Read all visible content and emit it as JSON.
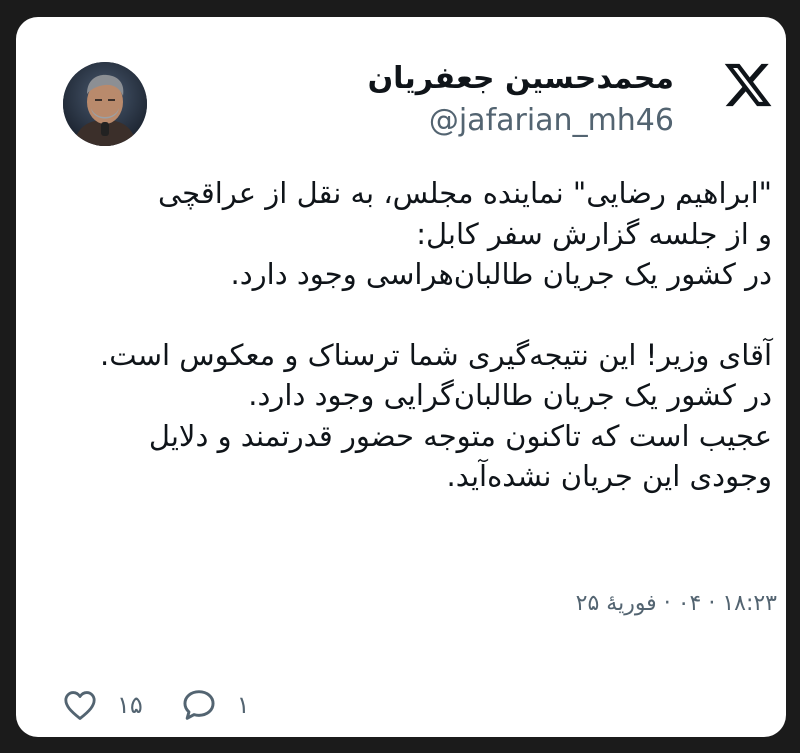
{
  "author": {
    "display_name": "محمدحسین جعفریان",
    "handle": "@jafarian_mh46"
  },
  "icons": {
    "platform": "x-logo-icon",
    "like": "heart-icon",
    "reply": "speech-bubble-icon"
  },
  "tweet": {
    "paragraph_1": "\"ابراهیم رضایی\" نماینده مجلس، به نقل از عراقچی\nو از جلسه گزارش سفر کابل:\n در کشور یک جریان طالبان‌هراسی وجود دارد.",
    "paragraph_2": "آقای وزیر! این نتیجه‌گیری شما ترسناک و معکوس است. در کشور یک جریان طالبان‌گرایی وجود دارد.\nعجیب است که تاکنون متوجه حضور قدرتمند و دلایل وجودی این جریان نشده‌آید.",
    "timestamp": "۱۸:۲۳ · ۰۴ · فوریهٔ ۲۵"
  },
  "stats": {
    "likes": "۱۵",
    "replies": "۱"
  },
  "colors": {
    "background": "#1b1b1b",
    "card": "#ffffff",
    "text_primary": "#0f1419",
    "text_secondary": "#536471"
  }
}
